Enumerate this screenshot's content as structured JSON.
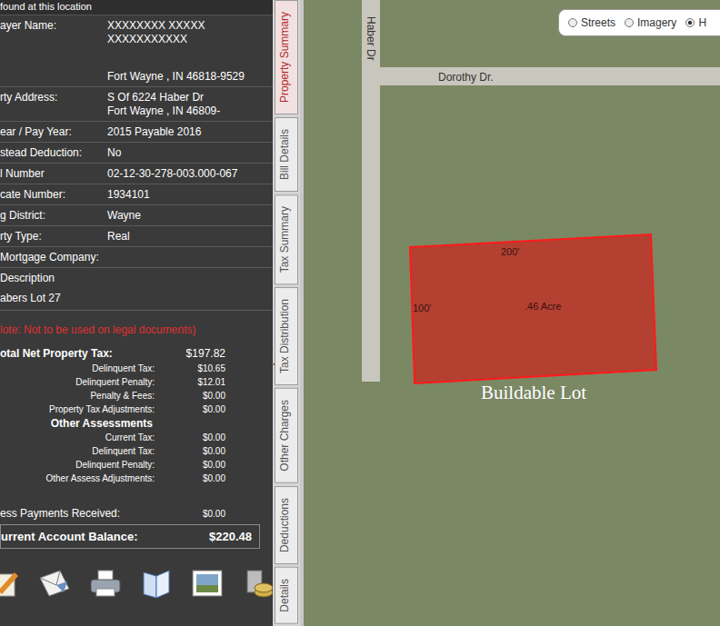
{
  "panel": {
    "title": "found at this location",
    "collapse": "◀"
  },
  "info_rows": [
    {
      "label": "ayer Name:",
      "values": [
        "XXXXXXXX XXXXX",
        "XXXXXXXXXXX",
        "Fort Wayne , IN 46818-9529"
      ]
    },
    {
      "label": "rty Address:",
      "values": [
        "S Of 6224 Haber Dr",
        "Fort Wayne , IN 46809-"
      ]
    },
    {
      "label": "ear / Pay Year:",
      "values": [
        "2015 Payable 2016"
      ]
    },
    {
      "label": "stead Deduction:",
      "values": [
        "No"
      ]
    },
    {
      "label": "l Number",
      "values": [
        "02-12-30-278-003.000-067"
      ]
    },
    {
      "label": "cate Number:",
      "values": [
        "1934101"
      ]
    },
    {
      "label": "g District:",
      "values": [
        "Wayne"
      ]
    },
    {
      "label": "rty Type:",
      "values": [
        "Real"
      ]
    },
    {
      "label": "Mortgage Company:",
      "values": []
    }
  ],
  "description": {
    "label": "Description",
    "value": "abers Lot 27"
  },
  "note": "lote: Not to be used on legal documents)",
  "tax_rows": [
    {
      "label": "otal Net Property Tax:",
      "value": "$197.82",
      "kind": "total"
    },
    {
      "label": "Delinquent Tax:",
      "value": "$10.65",
      "kind": "line"
    },
    {
      "label": "Delinquent Penalty:",
      "value": "$12.01",
      "kind": "line"
    },
    {
      "label": "Penalty & Fees:",
      "value": "$0.00",
      "kind": "line"
    },
    {
      "label": "Property Tax Adjustments:",
      "value": "$0.00",
      "kind": "line"
    },
    {
      "label": "Other Assessments",
      "value": "",
      "kind": "heading"
    },
    {
      "label": "Current Tax:",
      "value": "$0.00",
      "kind": "line"
    },
    {
      "label": "Delinquent Tax:",
      "value": "$0.00",
      "kind": "line"
    },
    {
      "label": "Delinquent Penalty:",
      "value": "$0.00",
      "kind": "line"
    },
    {
      "label": "Other Assess Adjustments:",
      "value": "$0.00",
      "kind": "line"
    }
  ],
  "payments": {
    "label": "ess Payments Received:",
    "value": "$0.00"
  },
  "balance": {
    "label": "urrent Account Balance:",
    "value": "$220.48"
  },
  "tabs": [
    {
      "label": "Property Summary",
      "selected": true
    },
    {
      "label": "Bill Details",
      "selected": false
    },
    {
      "label": "Tax Summary",
      "selected": false
    },
    {
      "label": "Tax Distribution",
      "selected": false
    },
    {
      "label": "Other Charges",
      "selected": false
    },
    {
      "label": "Deductions",
      "selected": false
    },
    {
      "label": "Details",
      "selected": false
    }
  ],
  "map": {
    "streets": [
      {
        "label": "Haber Dr"
      },
      {
        "label": "Dorothy Dr."
      }
    ],
    "layers": [
      {
        "label": "Streets",
        "selected": false
      },
      {
        "label": "Imagery",
        "selected": false
      },
      {
        "label": "H",
        "selected": true
      }
    ],
    "parcel": {
      "top": "200'",
      "side": "100'",
      "area": ".46 Acre"
    },
    "caption": "Buildable Lot"
  }
}
